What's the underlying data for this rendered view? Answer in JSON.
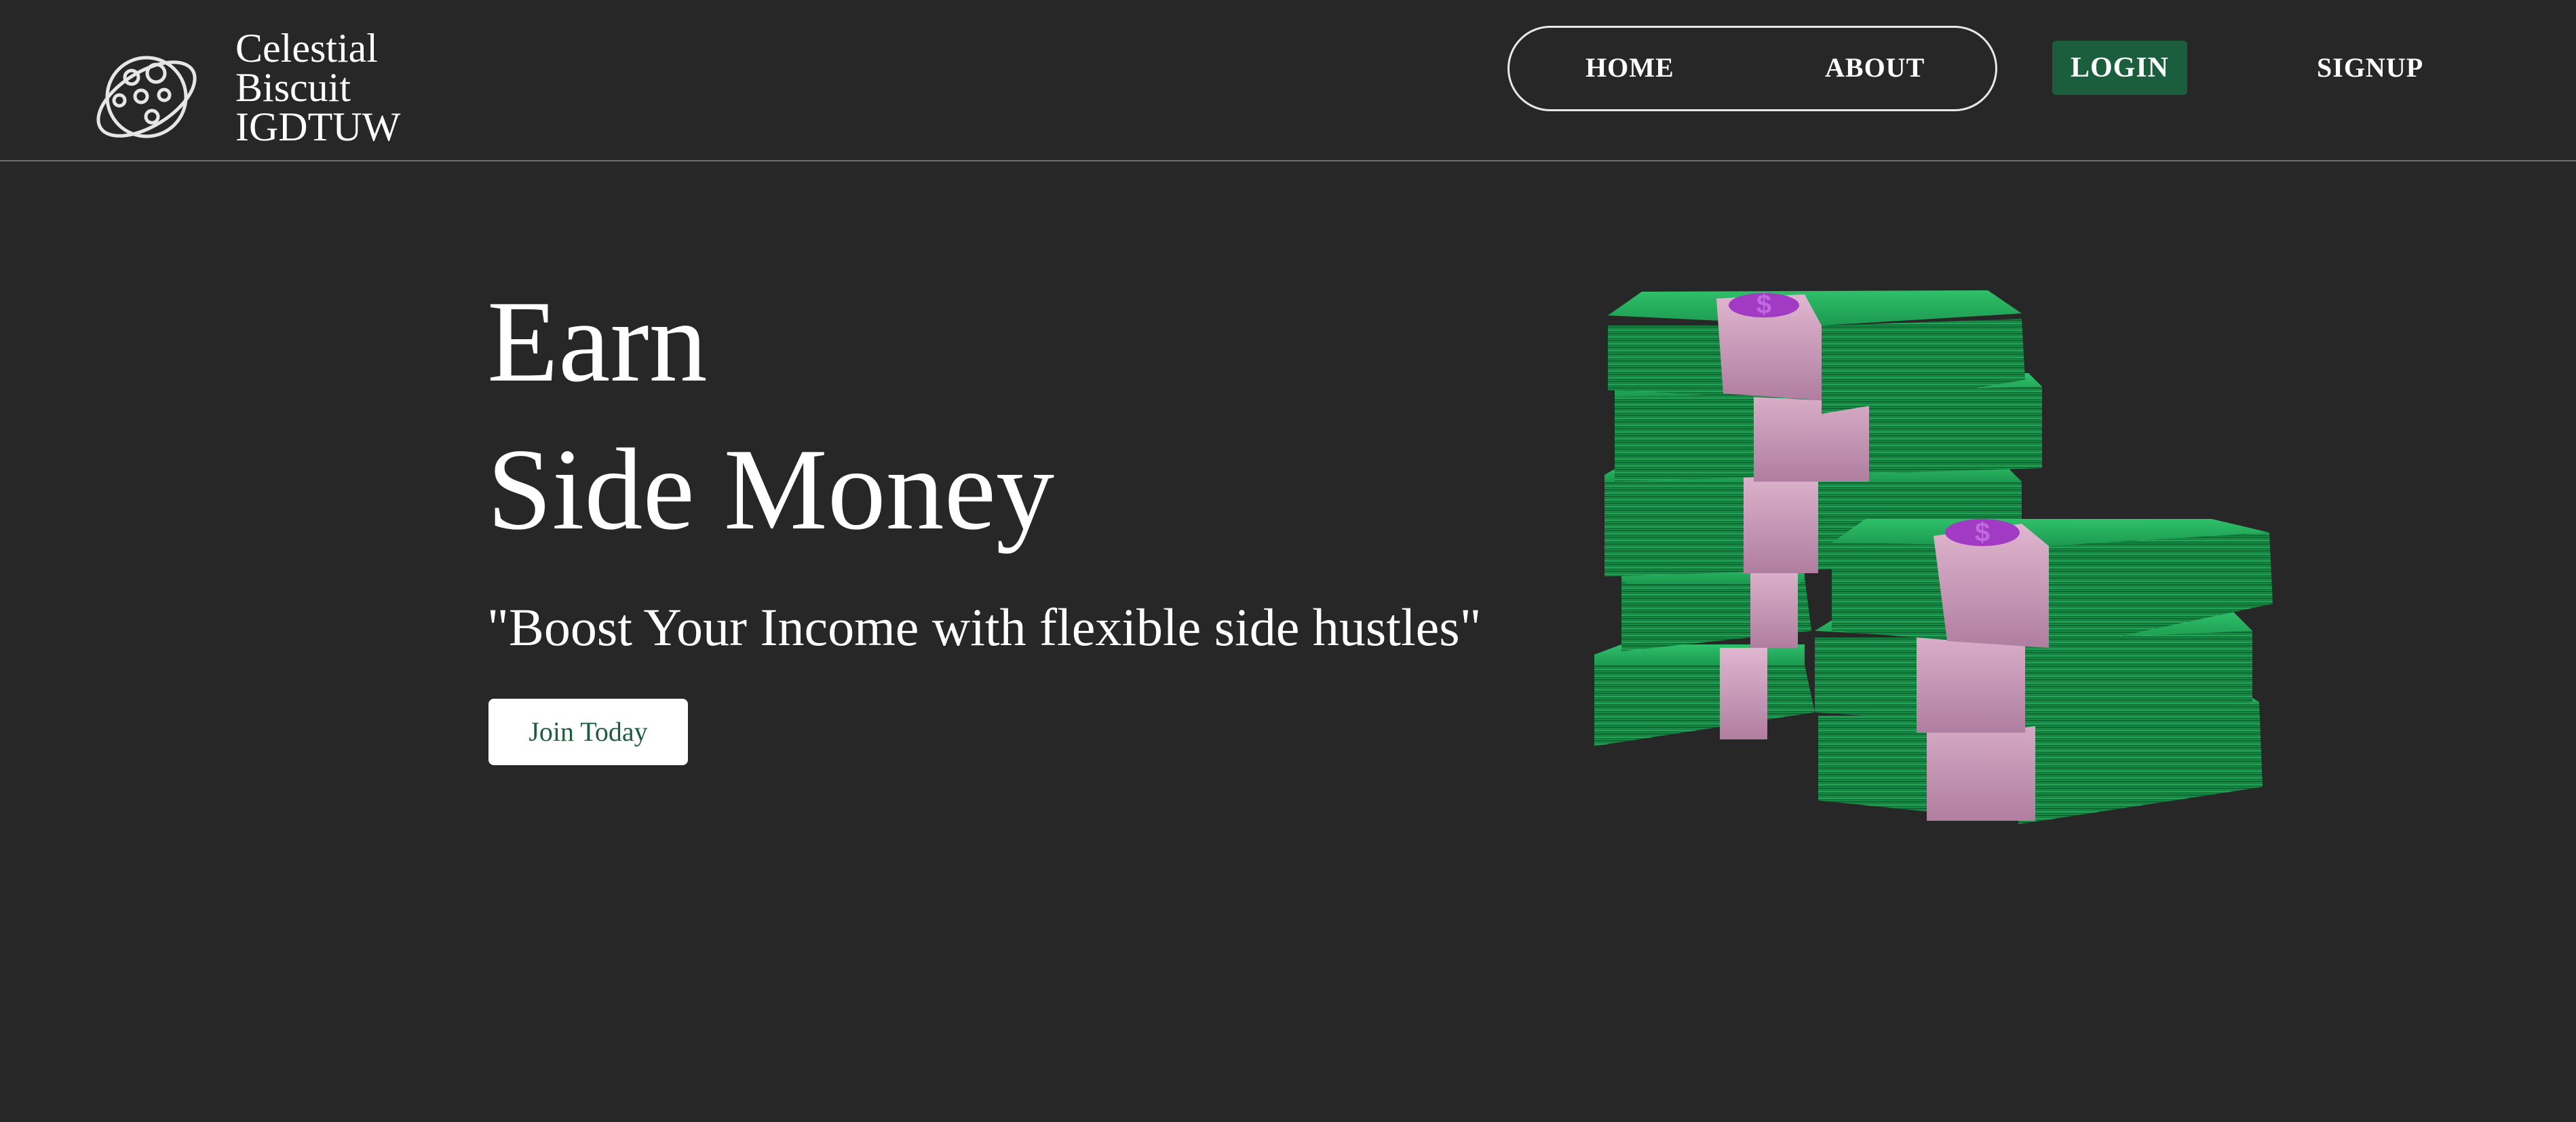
{
  "brand": {
    "line1": "Celestial",
    "line2": "Biscuit",
    "line3": "IGDTUW",
    "logo_icon": "planet-cookie-icon"
  },
  "nav": {
    "home": "HOME",
    "about": "ABOUT",
    "login": "LOGIN",
    "signup": "SIGNUP"
  },
  "hero": {
    "title_line1": "Earn",
    "title_line2": "Side Money",
    "tagline": "\"Boost Your Income with flexible side hustles\"",
    "cta": "Join Today",
    "illustration": "money-stacks-illustration"
  },
  "colors": {
    "background": "#272727",
    "accent_green": "#1b5e3e",
    "text": "#ffffff",
    "money_green": "#1fa456",
    "band_pink": "#c994b4",
    "dollar_purple": "#a23bc4"
  }
}
